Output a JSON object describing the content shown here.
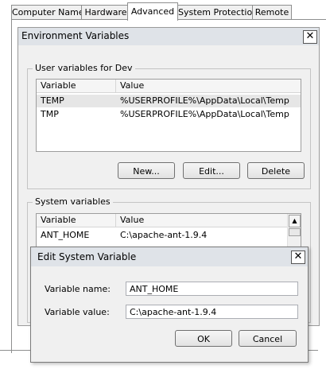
{
  "tabs": [
    {
      "label": "Computer Name"
    },
    {
      "label": "Hardware"
    },
    {
      "label": "Advanced"
    },
    {
      "label": "System Protection"
    },
    {
      "label": "Remote"
    }
  ],
  "env_window": {
    "title": "Environment Variables",
    "user_vars": {
      "group_label": "User variables for Dev",
      "columns": [
        "Variable",
        "Value"
      ],
      "rows": [
        {
          "variable": "TEMP",
          "value": "%USERPROFILE%\\AppData\\Local\\Temp"
        },
        {
          "variable": "TMP",
          "value": "%USERPROFILE%\\AppData\\Local\\Temp"
        }
      ],
      "buttons": {
        "new": "New...",
        "edit": "Edit...",
        "delete": "Delete"
      }
    },
    "system_vars": {
      "group_label": "System variables",
      "columns": [
        "Variable",
        "Value"
      ],
      "rows": [
        {
          "variable": "ANT_HOME",
          "value": "C:\\apache-ant-1.9.4"
        }
      ]
    }
  },
  "edit_dialog": {
    "title": "Edit System Variable",
    "name_label": "Variable name:",
    "name_value": "ANT_HOME",
    "value_label": "Variable value:",
    "value_value": "C:\\apache-ant-1.9.4",
    "ok": "OK",
    "cancel": "Cancel"
  },
  "icons": {
    "close": "close-icon",
    "scroll_up": "scroll-up-arrow-icon"
  },
  "colors": {
    "dialog_bg": "#f0f0f0",
    "titlebar_bg": "#dfe3e8",
    "selected_row": "#e6e6e6"
  }
}
